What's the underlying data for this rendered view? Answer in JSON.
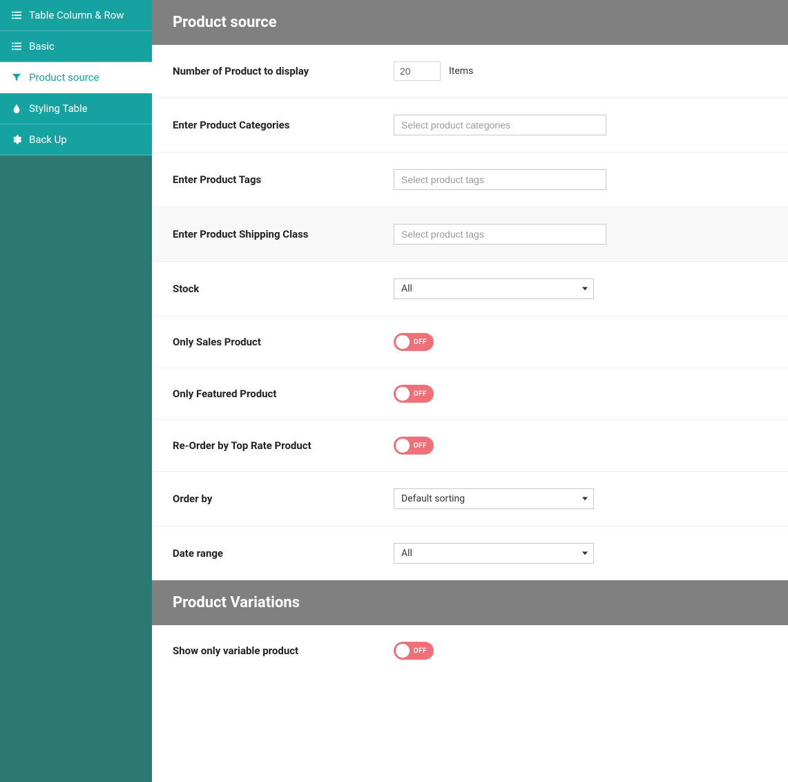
{
  "sidebar": {
    "items": [
      {
        "label": "Table Column & Row",
        "icon": "list"
      },
      {
        "label": "Basic",
        "icon": "list"
      },
      {
        "label": "Product source",
        "icon": "filter",
        "active": true
      },
      {
        "label": "Styling Table",
        "icon": "drop"
      },
      {
        "label": "Back Up",
        "icon": "gear"
      }
    ]
  },
  "sections": {
    "product_source": {
      "title": "Product source",
      "number_of_product": {
        "label": "Number of Product to display",
        "value": "20",
        "unit": "Items"
      },
      "categories": {
        "label": "Enter Product Categories",
        "placeholder": "Select product categories"
      },
      "tags": {
        "label": "Enter Product Tags",
        "placeholder": "Select product tags"
      },
      "shipping": {
        "label": "Enter Product Shipping Class",
        "placeholder": "Select product tags"
      },
      "stock": {
        "label": "Stock",
        "value": "All"
      },
      "only_sales": {
        "label": "Only Sales Product",
        "state": "OFF"
      },
      "only_featured": {
        "label": "Only Featured Product",
        "state": "OFF"
      },
      "reorder_top_rate": {
        "label": "Re-Order by Top Rate Product",
        "state": "OFF"
      },
      "order_by": {
        "label": "Order by",
        "value": "Default sorting"
      },
      "date_range": {
        "label": "Date range",
        "value": "All"
      }
    },
    "product_variations": {
      "title": "Product Variations",
      "show_only_variable": {
        "label": "Show only variable product",
        "state": "OFF"
      }
    }
  }
}
